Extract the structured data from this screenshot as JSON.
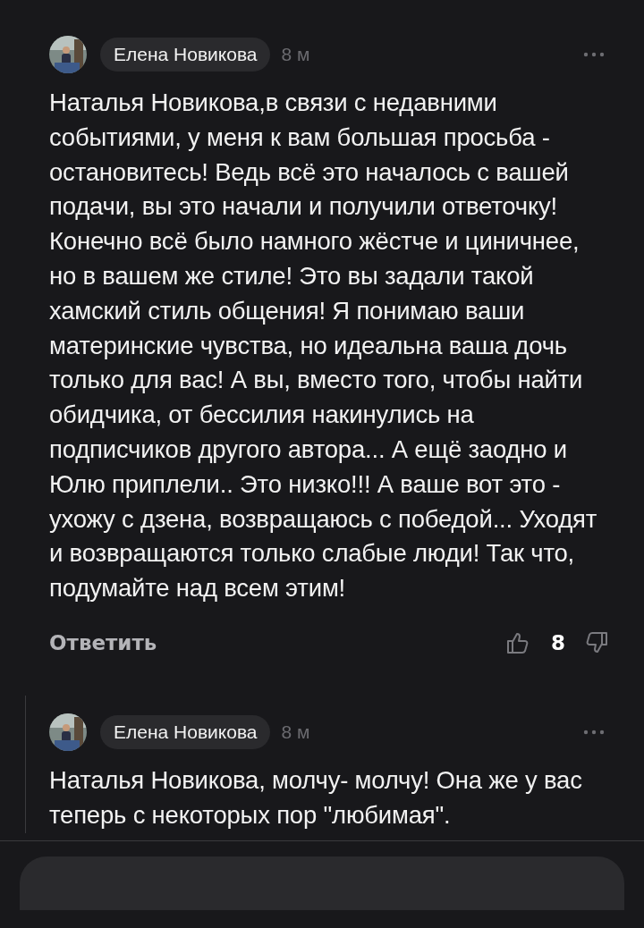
{
  "comments": [
    {
      "author": "Елена Новикова",
      "time": "8 м",
      "text": "Наталья Новикова,в связи с недавними событиями, у меня к вам большая просьба - остановитесь! Ведь всё это началось с вашей подачи, вы это начали и получили ответочку! Конечно всё было намного жёстче и циничнее, но в вашем же стиле! Это вы задали такой хамский стиль общения! Я понимаю ваши материнские чувства, но идеальна ваша дочь только для вас! А вы, вместо того, чтобы найти обидчика, от бессилия накинулись на подписчиков другого автора... А ещё заодно и Юлю приплели.. Это низко!!! А ваше вот это - ухожу с дзена, возвращаюсь с победой... Уходят и возвращаются только слабые люди! Так что, подумайте над всем этим!",
      "reply": "Ответить",
      "likes": "8",
      "thread": false
    },
    {
      "author": "Елена Новикова",
      "time": "8 м",
      "text": "Наталья Новикова, молчу- молчу! Она же у вас теперь с некоторых пор \"любимая\".",
      "thread": true
    }
  ],
  "composer": {
    "kind": "field"
  }
}
